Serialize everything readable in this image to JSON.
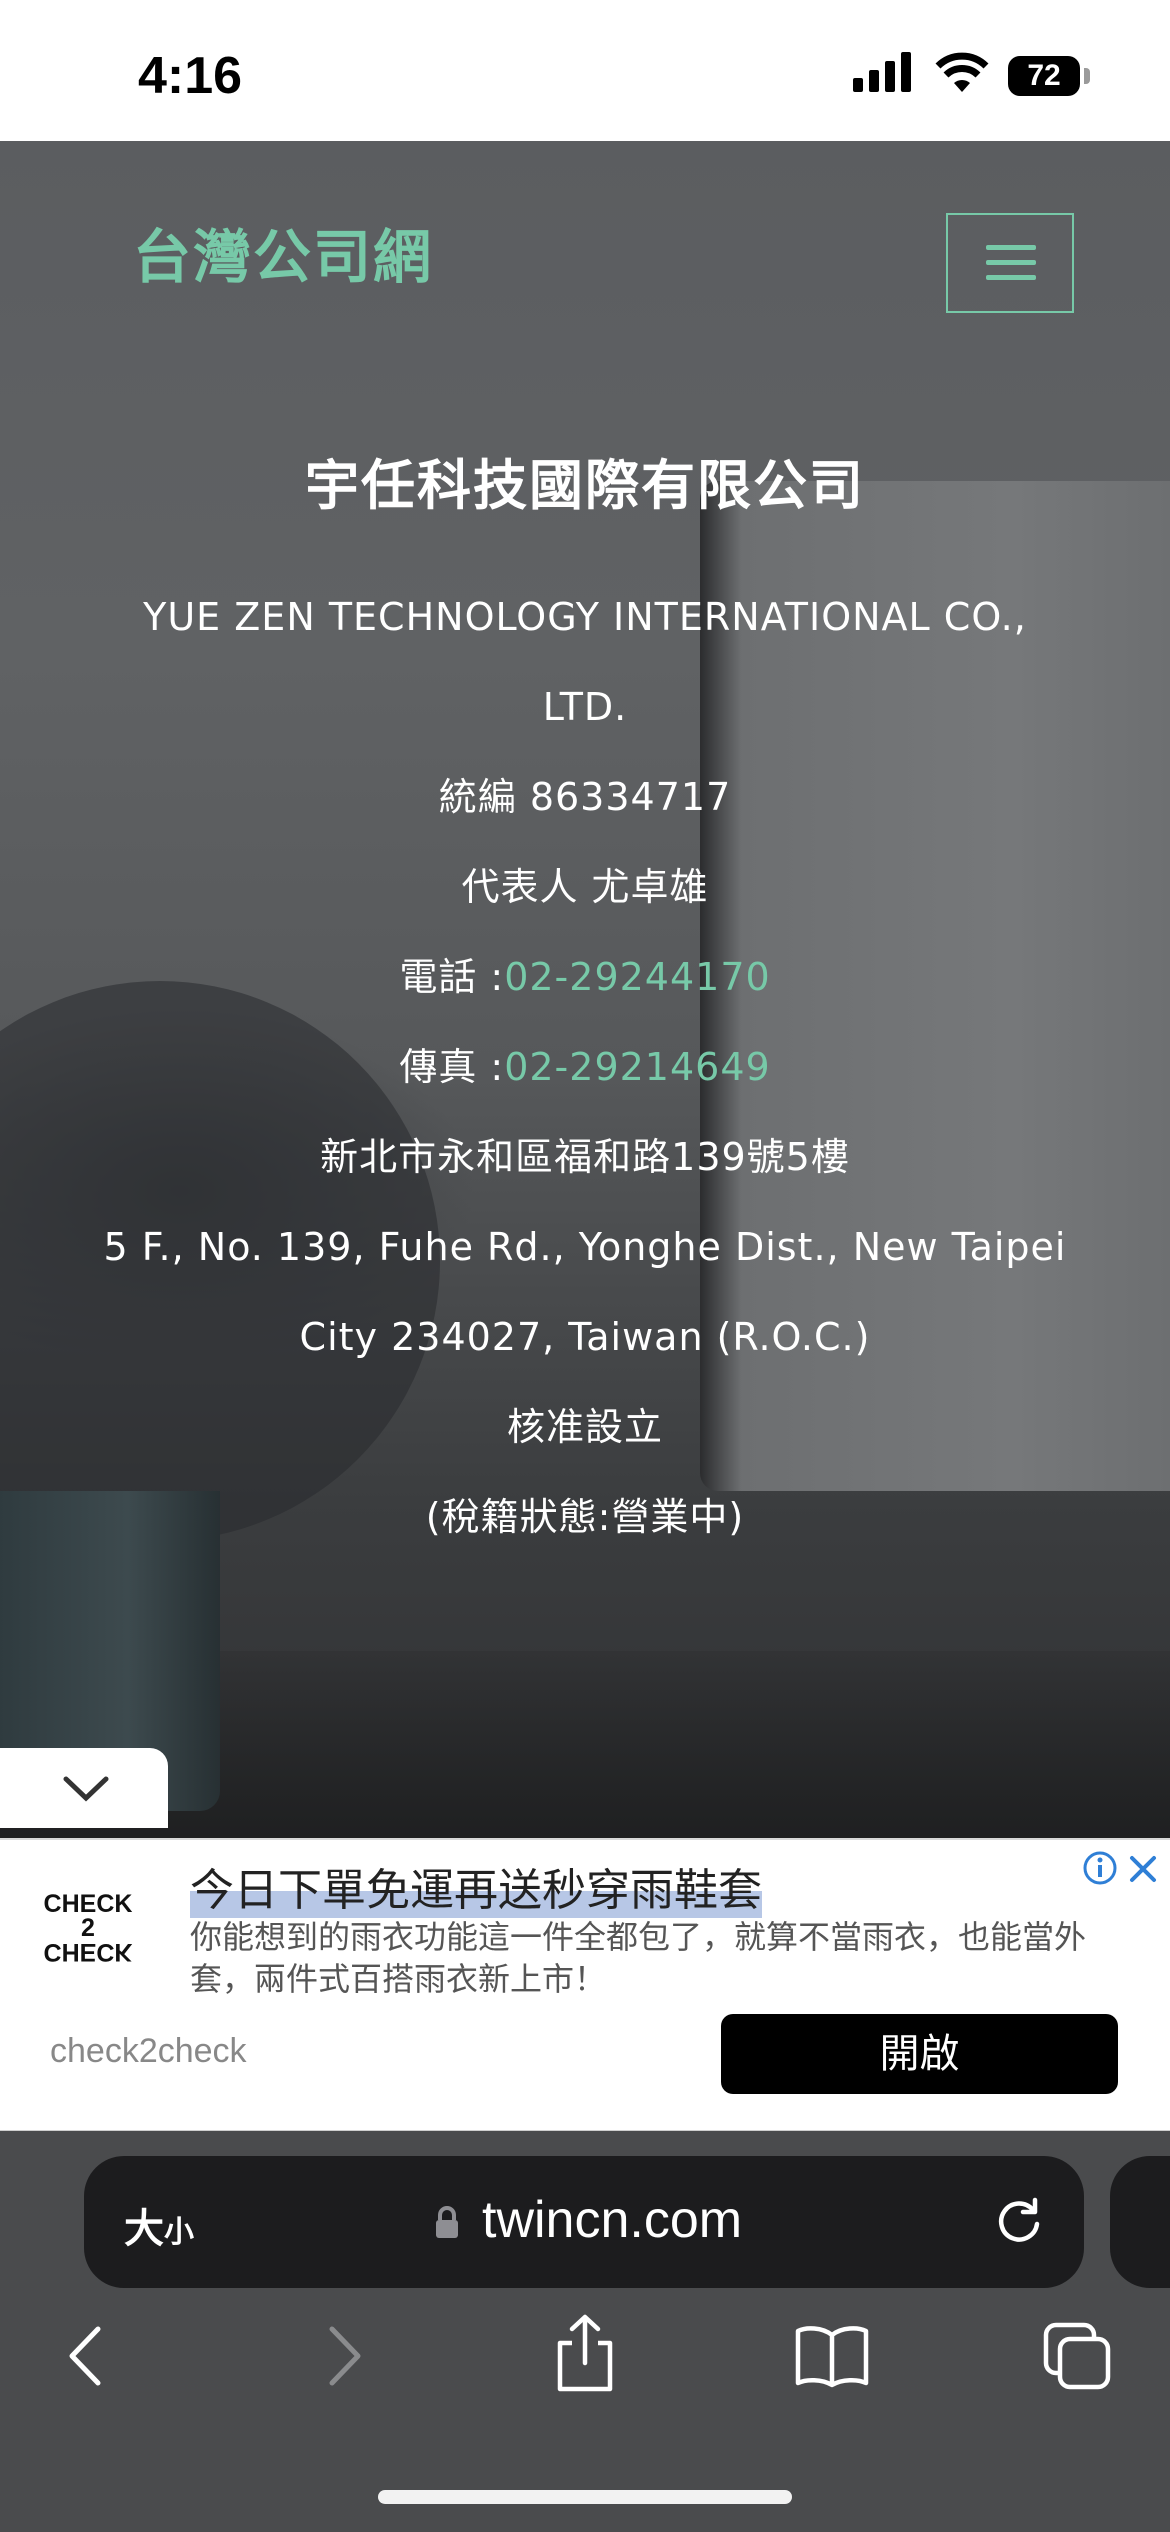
{
  "status_bar": {
    "time": "4:16",
    "battery": "72",
    "icons": [
      "signal-icon",
      "wifi-icon",
      "battery-icon"
    ]
  },
  "site": {
    "logo": "台灣公司網",
    "menu_icon": "hamburger-icon",
    "accent_color": "#77c9a8"
  },
  "company": {
    "name_zh": "宇任科技國際有限公司",
    "name_en_line1": "YUE ZEN TECHNOLOGY INTERNATIONAL CO.,",
    "name_en_line2": "LTD.",
    "tax_id": "統編 86334717",
    "representative": "代表人 尤卓雄",
    "phone_label": "電話 :",
    "phone": "02-29244170",
    "fax_label": "傳真 :",
    "fax": "02-29214649",
    "address_zh": "新北市永和區福和路139號5樓",
    "address_en_line1": "5 F., No. 139, Fuhe Rd., Yonghe Dist., New Taipei",
    "address_en_line2": "City 234027, Taiwan (R.O.C.)",
    "status": "核准設立",
    "tax_status": "(稅籍狀態:營業中)"
  },
  "ad": {
    "collapse_icon": "chevron-down-icon",
    "logo_line1": "CHECK",
    "logo_line2": "2",
    "logo_line3": "CHECK",
    "title": "今日下單免運再送秒穿雨鞋套",
    "description": "你能想到的雨衣功能這一件全都包了，就算不當雨衣，也能當外套，兩件式百搭雨衣新上市！",
    "brand": "check2check",
    "cta": "開啟",
    "info_icon": "info-icon",
    "close_icon": "close-icon"
  },
  "browser": {
    "text_size_label": "大",
    "text_size_small": "小",
    "domain": "twincn.com",
    "toolbar_icons": [
      "back-icon",
      "forward-icon",
      "share-icon",
      "bookmarks-icon",
      "tabs-icon"
    ]
  }
}
